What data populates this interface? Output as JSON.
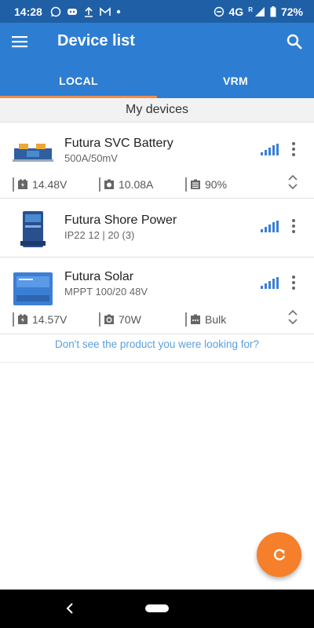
{
  "status_bar": {
    "time": "14:28",
    "network": "4G",
    "roaming": "R",
    "battery": "72%",
    "icons": [
      "whatsapp-icon",
      "discord-icon",
      "upload-icon",
      "gmail-icon",
      "dot-icon",
      "dnd-icon",
      "signal-icon",
      "battery-icon"
    ]
  },
  "app_bar": {
    "title": "Device list",
    "tabs": [
      {
        "label": "LOCAL",
        "active": true
      },
      {
        "label": "VRM",
        "active": false
      }
    ],
    "accent": "#f28b50",
    "background": "#2d7dd2"
  },
  "section": {
    "header": "My devices"
  },
  "devices": [
    {
      "name": "Futura SVC Battery",
      "subtitle": "500A/50mV",
      "stats": [
        {
          "icon": "battery-charge-icon",
          "value": "14.48V"
        },
        {
          "icon": "current-icon",
          "value": "10.08A"
        },
        {
          "icon": "soc-icon",
          "value": "90%"
        }
      ]
    },
    {
      "name": "Futura Shore Power",
      "subtitle": "IP22 12 | 20 (3)",
      "stats": []
    },
    {
      "name": "Futura Solar",
      "subtitle": "MPPT 100/20 48V",
      "stats": [
        {
          "icon": "battery-charge-icon",
          "value": "14.57V"
        },
        {
          "icon": "solar-power-icon",
          "value": "70W"
        },
        {
          "icon": "charge-state-icon",
          "value": "Bulk"
        }
      ]
    }
  ],
  "not_found_link": "Don't see the product you were looking for?",
  "fab": {
    "icon": "refresh-icon",
    "color": "#f57f2a"
  }
}
